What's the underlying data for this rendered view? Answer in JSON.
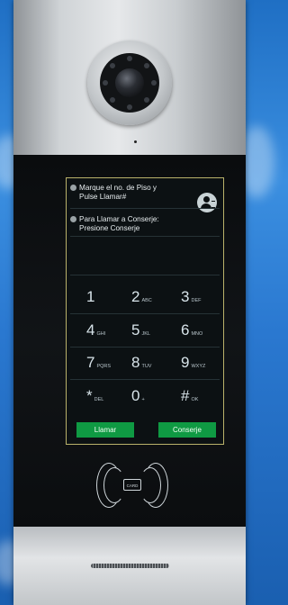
{
  "screen": {
    "messages": [
      {
        "line1": "Marque el no. de Piso y",
        "line2": "Pulse Llamar#"
      },
      {
        "line1": "Para Llamar a Conserje:",
        "line2": "Presione Conserje"
      }
    ],
    "keypad": [
      {
        "num": "1",
        "sub": ""
      },
      {
        "num": "2",
        "sub": "ABC"
      },
      {
        "num": "3",
        "sub": "DEF"
      },
      {
        "num": "4",
        "sub": "GHI"
      },
      {
        "num": "5",
        "sub": "JKL"
      },
      {
        "num": "6",
        "sub": "MNO"
      },
      {
        "num": "7",
        "sub": "PQRS"
      },
      {
        "num": "8",
        "sub": "TUV"
      },
      {
        "num": "9",
        "sub": "WXYZ"
      },
      {
        "num": "*",
        "sub": "DEL"
      },
      {
        "num": "0",
        "sub": "+"
      },
      {
        "num": "#",
        "sub": "OK"
      }
    ],
    "call_button": "Llamar",
    "concierge_button": "Conserje"
  },
  "card_reader": {
    "label": "CARD"
  },
  "colors": {
    "accent_green": "#0f9a43",
    "screen_border": "#b9b16a"
  }
}
